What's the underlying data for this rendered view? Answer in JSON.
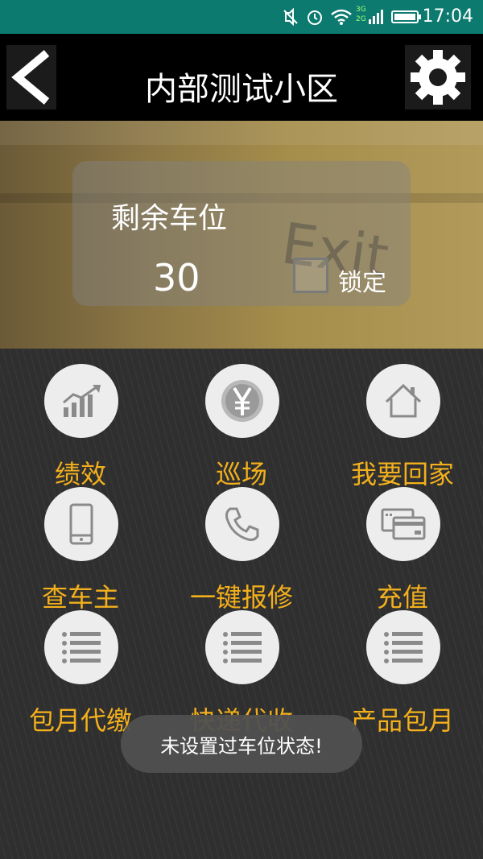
{
  "status": {
    "time": "17:04",
    "network": "3G 2G"
  },
  "header": {
    "title": "内部测试小区"
  },
  "parking": {
    "label": "剩余车位",
    "count": "30",
    "lock_label": "锁定",
    "hero_sign_text": "Exit"
  },
  "grid": [
    {
      "label": "绩效",
      "icon": "chart-up-icon"
    },
    {
      "label": "巡场",
      "icon": "yen-coin-icon"
    },
    {
      "label": "我要回家",
      "icon": "home-icon"
    },
    {
      "label": "查车主",
      "icon": "phone-icon"
    },
    {
      "label": "一键报修",
      "icon": "telephone-icon"
    },
    {
      "label": "充值",
      "icon": "credit-card-icon"
    },
    {
      "label": "包月代缴",
      "icon": "list-icon"
    },
    {
      "label": "快递代收",
      "icon": "list-icon"
    },
    {
      "label": "产品包月",
      "icon": "list-icon"
    }
  ],
  "toast": "未设置过车位状态!",
  "colors": {
    "accent": "#f3b01c",
    "statusbar": "#0c7a6f"
  }
}
